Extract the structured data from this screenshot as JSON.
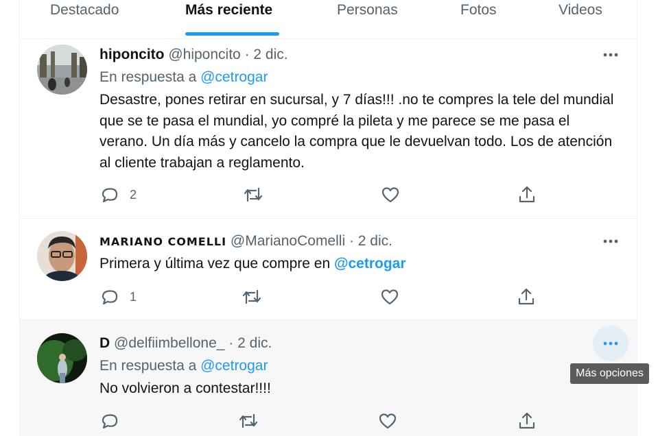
{
  "tabs": [
    {
      "label": "Destacado"
    },
    {
      "label": "Más reciente"
    },
    {
      "label": "Personas"
    },
    {
      "label": "Fotos"
    },
    {
      "label": "Videos"
    }
  ],
  "tweets": [
    {
      "name": "hiponcito",
      "handle": "@hiponcito",
      "dot": "·",
      "date": "2 dic.",
      "reply_prefix": "En respuesta a",
      "reply_to": "@cetrogar",
      "text": "Desastre, pones retirar en sucursal, y 7 días!!! .no te compres la tele del mundial que se te pasa el mundial, yo compré la pileta y me parece se me pasa el verano. Un día más y cancelo la compra que le devuelvan todo. Los de atención al cliente trabajan a reglamento.",
      "reply_count": "2"
    },
    {
      "name": "MARIANO COMELLI",
      "handle": "@MarianoComelli",
      "dot": "·",
      "date": "2 dic.",
      "text": "Primera y última vez que compre en",
      "text_mention": "@cetrogar",
      "reply_count": "1"
    },
    {
      "name": "D",
      "handle": "@delfiimbellone_",
      "dot": "·",
      "date": "2 dic.",
      "reply_prefix": "En respuesta a",
      "reply_to": "@cetrogar",
      "text": "No volvieron a contestar!!!!"
    }
  ],
  "tooltip": "Más opciones",
  "colors": {
    "accent": "#1d9bf0",
    "secondary_text": "#536471",
    "primary_text": "#0f1419"
  },
  "icons": {
    "more": "more-horizontal-icon",
    "reply": "reply-icon",
    "retweet": "retweet-icon",
    "like": "heart-icon",
    "share": "share-icon"
  }
}
